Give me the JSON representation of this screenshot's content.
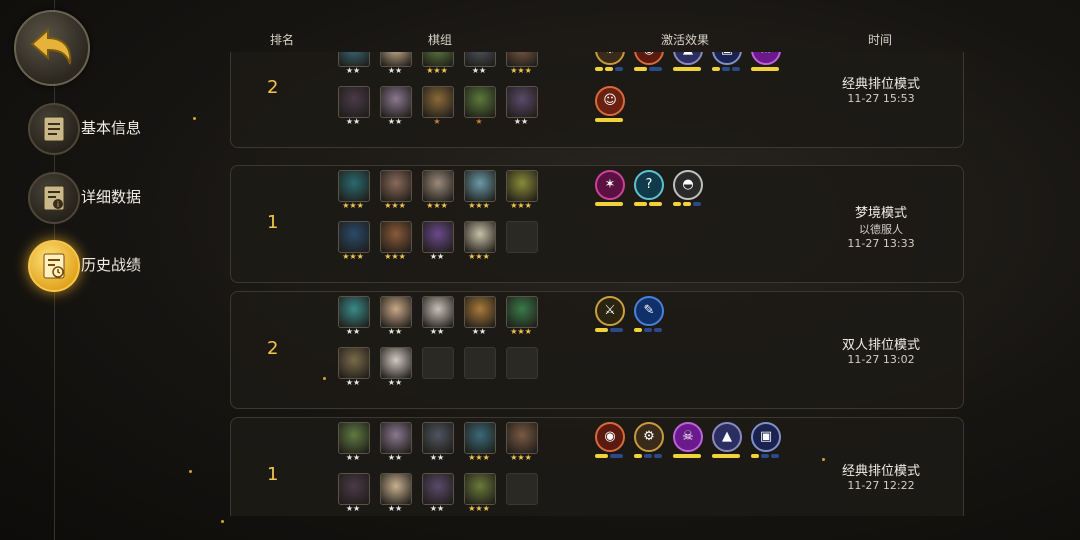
{
  "nav": {
    "items": [
      {
        "label": "基本信息",
        "icon": "document-icon"
      },
      {
        "label": "详细数据",
        "icon": "document-info-icon"
      },
      {
        "label": "历史战绩",
        "icon": "history-clock-icon",
        "active": true
      }
    ]
  },
  "header": {
    "rank": "排名",
    "units": "棋组",
    "traits": "激活效果",
    "time": "时间"
  },
  "rows": [
    {
      "rank": "2",
      "mode": "经典排位模式",
      "sub": "",
      "time": "11-27 15:53",
      "heroes": [
        {
          "color": "#3b6a78",
          "stars": "★★",
          "star_color": "#e8e8e8"
        },
        {
          "color": "#c8b090",
          "stars": "★★",
          "star_color": "#e8e8e8"
        },
        {
          "color": "#5f7a42",
          "stars": "★★★",
          "star_color": "#f2c64c"
        },
        {
          "color": "#4f5560",
          "stars": "★★",
          "star_color": "#e8e8e8"
        },
        {
          "color": "#7a5a44",
          "stars": "★★★",
          "star_color": "#f2c64c"
        },
        {
          "color": "#4a3a48",
          "stars": "★★",
          "star_color": "#e8e8e8"
        },
        {
          "color": "#8a7890",
          "stars": "★★",
          "star_color": "#e8e8e8"
        },
        {
          "color": "#8a6a3a",
          "stars": "★",
          "star_color": "#c87d3a"
        },
        {
          "color": "#5a7a3a",
          "stars": "★",
          "star_color": "#c87d3a"
        },
        {
          "color": "#5a4a6a",
          "stars": "★★",
          "star_color": "#e8e8e8"
        }
      ],
      "traits": [
        {
          "icon": "gear-icon",
          "glyph": "⚙",
          "color": "#3a2a1a",
          "border": "#c89a40",
          "pips": [
            "#f2d23a",
            "#f2d23a",
            "#2a4a8a"
          ]
        },
        {
          "icon": "demon-icon",
          "glyph": "◉",
          "color": "#5a1a10",
          "border": "#d86a3a",
          "pips": [
            "#f2d23a",
            "#2a4a8a"
          ]
        },
        {
          "icon": "wizard-hat-icon",
          "glyph": "▲",
          "color": "#2a2e60",
          "border": "#8a8ac0",
          "pips": [
            "#f2d23a"
          ]
        },
        {
          "icon": "spellbook-icon",
          "glyph": "▣",
          "color": "#1a2250",
          "border": "#8090c8",
          "pips": [
            "#f2d23a",
            "#2a4a8a",
            "#2a4a8a"
          ]
        },
        {
          "icon": "skull-icon",
          "glyph": "☠",
          "color": "#6a1a8a",
          "border": "#c060e0",
          "pips": [
            "#f2d23a"
          ]
        },
        {
          "icon": "ogre-face-icon",
          "glyph": "☺",
          "color": "#6a2010",
          "border": "#d86a3a",
          "pips": [
            "#f2d23a"
          ]
        }
      ]
    },
    {
      "rank": "1",
      "mode": "梦境模式",
      "sub": "以德服人",
      "time": "11-27 13:33",
      "heroes": [
        {
          "color": "#2a6a70",
          "stars": "★★★",
          "star_color": "#f2c64c"
        },
        {
          "color": "#8a6a5a",
          "stars": "★★★",
          "star_color": "#f2c64c"
        },
        {
          "color": "#9a8a7a",
          "stars": "★★★",
          "star_color": "#f2c64c"
        },
        {
          "color": "#6a9aa8",
          "stars": "★★★",
          "star_color": "#f2c64c"
        },
        {
          "color": "#8a8a3a",
          "stars": "★★★",
          "star_color": "#f2c64c"
        },
        {
          "color": "#2a4a6a",
          "stars": "★★★",
          "star_color": "#f2c64c"
        },
        {
          "color": "#8a5a3a",
          "stars": "★★★",
          "star_color": "#f2c64c"
        },
        {
          "color": "#6a4a8a",
          "stars": "★★",
          "star_color": "#e8e8e8"
        },
        {
          "color": "#c8c0a8",
          "stars": "★★★",
          "star_color": "#f2c64c"
        },
        {
          "empty": true
        }
      ],
      "traits": [
        {
          "icon": "claw-icon",
          "glyph": "✶",
          "color": "#5a1040",
          "border": "#d0409a",
          "pips": [
            "#f2d23a"
          ]
        },
        {
          "icon": "question-icon",
          "glyph": "?",
          "color": "#103a4a",
          "border": "#60c0d0",
          "pips": [
            "#f2d23a",
            "#f2d23a"
          ]
        },
        {
          "icon": "helmet-icon",
          "glyph": "◓",
          "color": "#2a2a2a",
          "border": "#c0c0c0",
          "pips": [
            "#f2d23a",
            "#f2d23a",
            "#2a4a8a"
          ]
        }
      ]
    },
    {
      "rank": "2",
      "mode": "双人排位模式",
      "sub": "",
      "time": "11-27 13:02",
      "heroes": [
        {
          "color": "#3a8a8a",
          "stars": "★★",
          "star_color": "#e8e8e8"
        },
        {
          "color": "#c8a888",
          "stars": "★★",
          "star_color": "#e8e8e8"
        },
        {
          "color": "#c8c0b8",
          "stars": "★★",
          "star_color": "#e8e8e8"
        },
        {
          "color": "#a87a3a",
          "stars": "★★",
          "star_color": "#e8e8e8"
        },
        {
          "color": "#3a7a4a",
          "stars": "★★★",
          "star_color": "#f2c64c"
        },
        {
          "color": "#7a6a4a",
          "stars": "★★",
          "star_color": "#e8e8e8"
        },
        {
          "color": "#d0c8c0",
          "stars": "★★",
          "star_color": "#e8e8e8"
        },
        {
          "empty": true
        },
        {
          "empty": true
        },
        {
          "empty": true
        }
      ],
      "traits": [
        {
          "icon": "daggers-icon",
          "glyph": "⚔",
          "color": "#2a2410",
          "border": "#c8a040",
          "pips": [
            "#f2d23a",
            "#2a4a8a"
          ]
        },
        {
          "icon": "feather-icon",
          "glyph": "✎",
          "color": "#10306a",
          "border": "#4a80d8",
          "pips": [
            "#f2d23a",
            "#2a4a8a",
            "#2a4a8a"
          ]
        }
      ]
    },
    {
      "rank": "1",
      "mode": "经典排位模式",
      "sub": "",
      "time": "11-27 12:22",
      "heroes": [
        {
          "color": "#5f7a42",
          "stars": "★★",
          "star_color": "#e8e8e8"
        },
        {
          "color": "#8a7890",
          "stars": "★★",
          "star_color": "#e8e8e8"
        },
        {
          "color": "#4f5560",
          "stars": "★★",
          "star_color": "#e8e8e8"
        },
        {
          "color": "#3b6a78",
          "stars": "★★★",
          "star_color": "#f2c64c"
        },
        {
          "color": "#7a5a44",
          "stars": "★★★",
          "star_color": "#f2c64c"
        },
        {
          "color": "#4a3a48",
          "stars": "★★",
          "star_color": "#e8e8e8"
        },
        {
          "color": "#c8b090",
          "stars": "★★",
          "star_color": "#e8e8e8"
        },
        {
          "color": "#5a4a6a",
          "stars": "★★",
          "star_color": "#e8e8e8"
        },
        {
          "color": "#6a7a3a",
          "stars": "★★★",
          "star_color": "#f2c64c"
        },
        {
          "empty": true
        }
      ],
      "traits": [
        {
          "icon": "demon-icon",
          "glyph": "◉",
          "color": "#5a1a10",
          "border": "#d86a3a",
          "pips": [
            "#f2d23a",
            "#2a4a8a"
          ]
        },
        {
          "icon": "gear-icon",
          "glyph": "⚙",
          "color": "#3a2a1a",
          "border": "#c89a40",
          "pips": [
            "#f2d23a",
            "#2a4a8a",
            "#2a4a8a"
          ]
        },
        {
          "icon": "skull-icon",
          "glyph": "☠",
          "color": "#6a1a8a",
          "border": "#c060e0",
          "pips": [
            "#f2d23a"
          ]
        },
        {
          "icon": "wizard-hat-icon",
          "glyph": "▲",
          "color": "#2a2e60",
          "border": "#8a8ac0",
          "pips": [
            "#f2d23a"
          ]
        },
        {
          "icon": "spellbook-icon",
          "glyph": "▣",
          "color": "#1a2250",
          "border": "#8090c8",
          "pips": [
            "#f2d23a",
            "#2a4a8a",
            "#2a4a8a"
          ]
        }
      ]
    }
  ]
}
